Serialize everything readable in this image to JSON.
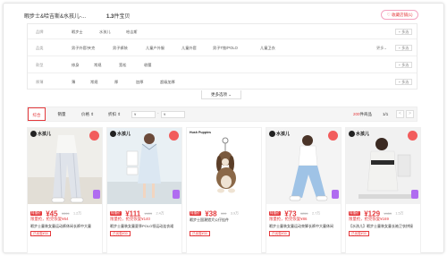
{
  "header": {
    "title": "暇步士&哈吉斯&水孩儿-...",
    "count": "1.3",
    "count_unit": "件宝贝",
    "favorite_label": "收藏店铺(1)"
  },
  "filters": {
    "more_label": "更多",
    "multi_label": "+ 多选",
    "rows": [
      {
        "label": "品牌",
        "options": [
          "暇步士",
          "水孩儿",
          "哈吉斯"
        ],
        "has_more": false
      },
      {
        "label": "品类",
        "options": [
          "男子外套/夹克",
          "男子裤装",
          "儿童户外服",
          "儿童外套",
          "男子T恤/POLO",
          "儿童卫衣"
        ],
        "has_more": true
      },
      {
        "label": "款型",
        "options": [
          "修身",
          "常规",
          "宽松",
          "收腰"
        ],
        "has_more": false
      },
      {
        "label": "厚薄",
        "options": [
          "薄",
          "常规",
          "厚",
          "加厚",
          "超级加厚"
        ],
        "has_more": false
      }
    ],
    "expand_label": "更多选项 ⌄"
  },
  "sort": {
    "options": [
      "综合",
      "销量",
      "价格 ⇕",
      "折扣 ⇕"
    ],
    "price_min_placeholder": "¥",
    "price_max_placeholder": "¥",
    "price_dash": "-",
    "result_count": "200",
    "result_suffix": "件商品",
    "page": "1/1",
    "prev": "<",
    "next": ">"
  },
  "products": [
    {
      "tag": "特惠价",
      "price": "¥45",
      "old_price": "¥399",
      "sold": "1.2万",
      "promo": "限量抢，抢完恢复¥64",
      "desc": "暇步士童装女童运动裤休闲长裤中大童",
      "coupon": "已优惠¥30",
      "brand": "水孩儿"
    },
    {
      "tag": "特惠价",
      "price": "¥111",
      "old_price": "¥499",
      "sold": "2.4万",
      "promo": "限量抢，抢完恢复¥140",
      "desc": "暇步士童装女童夏季POLO领运动连衣裙",
      "coupon": "已优惠¥30",
      "brand": "水孩儿"
    },
    {
      "tag": "特惠价",
      "price": "¥38",
      "old_price": "¥99",
      "sold": "3.9万",
      "promo": "",
      "desc": "暇步士国潮猎犬公仔挂件",
      "coupon": "已优惠¥30",
      "brand": "Hush Puppies"
    },
    {
      "tag": "特惠价",
      "price": "¥73",
      "old_price": "¥259",
      "sold": "2.7万",
      "promo": "限量抢，抢完恢复¥86",
      "desc": "暇步士童装女童运动束脚长裤中大童休闲",
      "coupon": "已优惠¥30",
      "brand": "水孩儿"
    },
    {
      "tag": "特惠价",
      "price": "¥129",
      "old_price": "¥459",
      "sold": "1.5万",
      "promo": "限量抢，抢完恢复¥169",
      "desc": "【水孩儿】暇步士童装女童长袖卫衣拼接",
      "coupon": "已优惠¥30",
      "brand": "水孩儿"
    }
  ],
  "colors": {
    "accent": "#e4393c",
    "badge_purple": "#b06cf0"
  }
}
